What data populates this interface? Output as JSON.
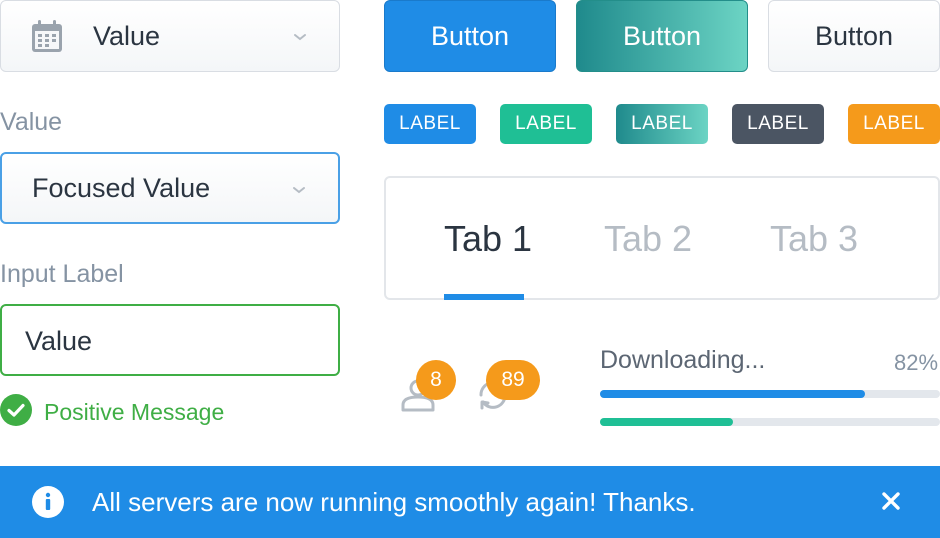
{
  "date_select": {
    "value": "Value",
    "icon": "calendar-icon"
  },
  "focused_select": {
    "label": "Value",
    "value": "Focused Value"
  },
  "input": {
    "label": "Input Label",
    "value": "Value",
    "message": "Positive Message"
  },
  "buttons": {
    "primary": "Button",
    "gradient": "Button",
    "default": "Button"
  },
  "labels": [
    "LABEL",
    "LABEL",
    "LABEL",
    "LABEL",
    "LABEL"
  ],
  "tabs": [
    "Tab 1",
    "Tab 2",
    "Tab 3"
  ],
  "active_tab": 0,
  "notifications": {
    "user_count": "8",
    "sync_count": "89"
  },
  "download": {
    "label": "Downloading...",
    "percent_text": "82%",
    "progress_1": 0.78,
    "progress_2": 0.39
  },
  "alert": {
    "message": "All servers are now running smoothly again! Thanks."
  },
  "colors": {
    "primary": "#1f8ce6",
    "success": "#3fae45",
    "teal": "#1fbf95",
    "orange": "#f59a1b",
    "dark": "#4b5563"
  }
}
